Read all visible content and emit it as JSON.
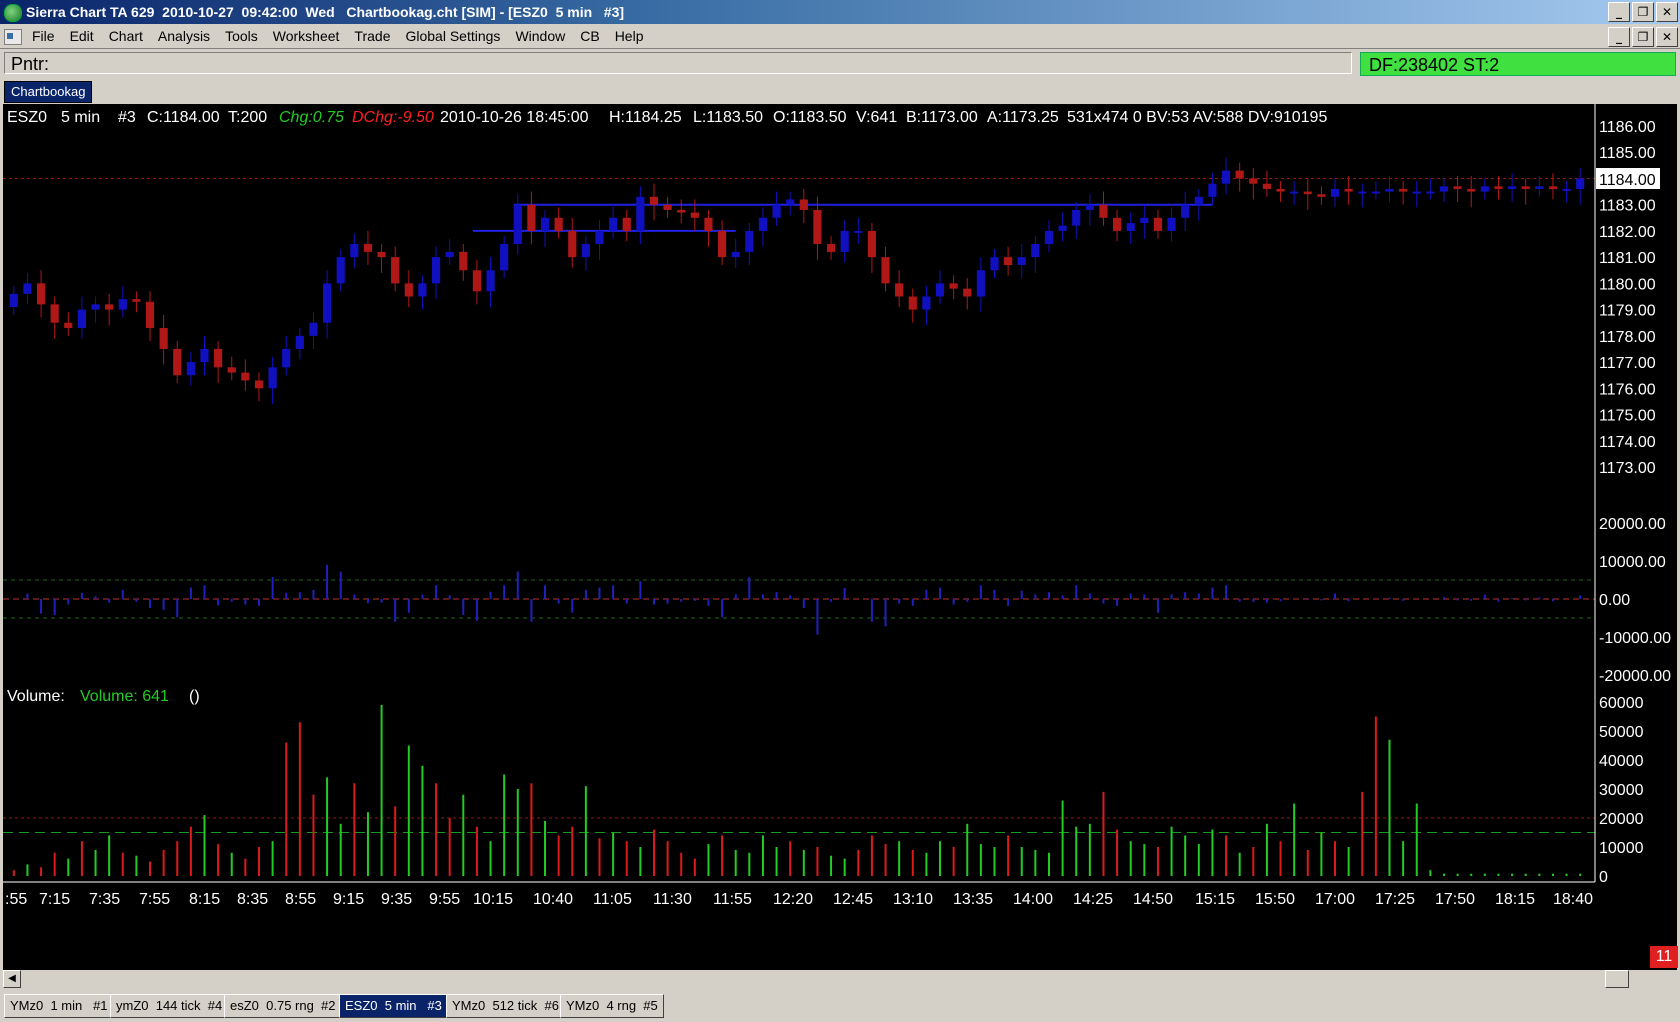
{
  "window": {
    "title": "Sierra Chart TA 629  2010-10-27  09:42:00  Wed   Chartbookag.cht [SIM] - [ESZ0  5 min   #3]",
    "buttons": [
      "_",
      "❐",
      "✕"
    ]
  },
  "menu": {
    "items": [
      "File",
      "Edit",
      "Chart",
      "Analysis",
      "Tools",
      "Worksheet",
      "Trade",
      "Global Settings",
      "Window",
      "CB",
      "Help"
    ]
  },
  "pointer_bar": {
    "label": "Pntr:",
    "status": "DF:238402   ST:2"
  },
  "chartbook_tab": "Chartbookag",
  "chart_header": {
    "symbol": "ESZ0",
    "interval": "5 min",
    "chart_no": "#3",
    "close": "C:1184.00",
    "trades": "T:200",
    "chg": "Chg:0.75",
    "dchg": "DChg:-9.50",
    "datetime": "2010-10-26 18:45:00",
    "high": "H:1184.25",
    "low": "L:1183.50",
    "open": "O:1183.50",
    "vol": "V:641",
    "bid": "B:1173.00",
    "ask": "A:1173.25",
    "tail": "531x474 0 BV:53 AV:588 DV:910195"
  },
  "volume_header": {
    "label": "Volume:",
    "value": "Volume: 641",
    "paren": "()"
  },
  "price_axis": [
    "1186.00",
    "1185.00",
    "1184.00",
    "1183.00",
    "1182.00",
    "1181.00",
    "1180.00",
    "1179.00",
    "1178.00",
    "1177.00",
    "1176.00",
    "1175.00",
    "1174.00",
    "1173.00"
  ],
  "current_price_label": "1184.00",
  "delta_axis": [
    "20000.00",
    "10000.00",
    "0.00",
    "-10000.00",
    "-20000.00"
  ],
  "volume_axis": [
    "60000",
    "50000",
    "40000",
    "30000",
    "20000",
    "10000",
    "0"
  ],
  "time_axis": [
    ":55",
    "7:15",
    "7:35",
    "7:55",
    "8:15",
    "8:35",
    "8:55",
    "9:15",
    "9:35",
    "9:55",
    "10:15",
    "10:40",
    "11:05",
    "11:30",
    "11:55",
    "12:20",
    "12:45",
    "13:10",
    "13:35",
    "14:00",
    "14:25",
    "14:50",
    "15:15",
    "15:50",
    "17:00",
    "17:25",
    "17:50",
    "18:15",
    "18:40"
  ],
  "bottom_right_badge": "11",
  "chart_tabs": [
    {
      "label": "YMz0  1 min   #1",
      "active": false
    },
    {
      "label": "ymZ0  144 tick  #4",
      "active": false
    },
    {
      "label": "esZ0  0.75 rng  #2",
      "active": false
    },
    {
      "label": "ESZ0  5 min   #3",
      "active": true
    },
    {
      "label": "YMz0  512 tick  #6",
      "active": false
    },
    {
      "label": "YMz0  4 rng  #5",
      "active": false
    }
  ],
  "colors": {
    "up": "#1010c0",
    "down": "#b01818",
    "vol_up": "#22cc22",
    "vol_down": "#dd1a1a",
    "bg": "#000000",
    "positive": "#22cc22",
    "negative": "#ff2020"
  },
  "chart_data": [
    {
      "type": "candlestick",
      "title": "ESZ0  5 min",
      "ylim": [
        1172.0,
        1186.5
      ],
      "current_price": 1184.0,
      "closes": [
        1179.6,
        1180.0,
        1179.2,
        1178.5,
        1178.3,
        1179.0,
        1179.2,
        1179.0,
        1179.4,
        1179.3,
        1178.3,
        1177.5,
        1176.5,
        1177.0,
        1177.5,
        1176.8,
        1176.6,
        1176.3,
        1176.0,
        1176.8,
        1177.5,
        1178.0,
        1178.5,
        1180.0,
        1181.0,
        1181.5,
        1181.2,
        1181.0,
        1180.0,
        1179.5,
        1180.0,
        1181.0,
        1181.2,
        1180.5,
        1179.7,
        1180.5,
        1181.5,
        1183.0,
        1182.0,
        1182.5,
        1182.0,
        1181.0,
        1181.5,
        1182.0,
        1182.5,
        1182.0,
        1183.3,
        1183.0,
        1182.8,
        1182.7,
        1182.5,
        1182.0,
        1181.0,
        1181.2,
        1182.0,
        1182.5,
        1183.0,
        1183.2,
        1182.8,
        1181.5,
        1181.2,
        1182.0,
        1182.0,
        1181.0,
        1180.0,
        1179.5,
        1179.0,
        1179.5,
        1180.0,
        1179.8,
        1179.5,
        1180.5,
        1181.0,
        1180.7,
        1181.0,
        1181.5,
        1182.0,
        1182.2,
        1182.8,
        1183.0,
        1182.5,
        1182.0,
        1182.3,
        1182.5,
        1182.0,
        1182.5,
        1183.0,
        1183.3,
        1183.8,
        1184.3,
        1184.0,
        1183.8,
        1183.6,
        1183.5,
        1183.5,
        1183.4,
        1183.3,
        1183.6,
        1183.5,
        1183.5,
        1183.5,
        1183.6,
        1183.5,
        1183.5,
        1183.5,
        1183.7,
        1183.6,
        1183.5,
        1183.7,
        1183.6,
        1183.7,
        1183.6,
        1183.7,
        1183.6,
        1183.6,
        1184.0
      ]
    },
    {
      "type": "bar",
      "title": "Volume",
      "ylim": [
        0,
        62000
      ],
      "values": [
        2000,
        4000,
        3000,
        8000,
        6000,
        12000,
        9000,
        14000,
        8000,
        7000,
        5000,
        9000,
        12000,
        17000,
        21000,
        11000,
        8000,
        6000,
        10000,
        12000,
        46000,
        53000,
        28000,
        34000,
        18000,
        32000,
        22000,
        59000,
        24000,
        45000,
        38000,
        32000,
        20000,
        28000,
        17000,
        12000,
        35000,
        30000,
        32000,
        19000,
        14000,
        17000,
        31000,
        13000,
        15000,
        12000,
        10000,
        16000,
        12000,
        8000,
        6000,
        11000,
        14000,
        9000,
        8000,
        14000,
        10000,
        12000,
        9000,
        10000,
        7000,
        6000,
        9000,
        14000,
        11000,
        12000,
        9000,
        8000,
        12000,
        10000,
        18000,
        11000,
        10000,
        14000,
        10000,
        9000,
        8000,
        26000,
        17000,
        18000,
        29000,
        16000,
        12000,
        11000,
        10000,
        17000,
        14000,
        11000,
        16000,
        14000,
        8000,
        10000,
        18000,
        12000,
        25000,
        9000,
        15000,
        12000,
        10000,
        29000,
        55000,
        47000,
        12000,
        25000,
        2000,
        800,
        800,
        800,
        800,
        800,
        800,
        800,
        800,
        800,
        800,
        800
      ],
      "up_flags": [
        0,
        1,
        0,
        0,
        1,
        0,
        1,
        1,
        0,
        1,
        0,
        0,
        0,
        0,
        1,
        0,
        1,
        0,
        0,
        1,
        0,
        0,
        0,
        1,
        1,
        0,
        1,
        1,
        0,
        1,
        1,
        0,
        0,
        1,
        0,
        1,
        1,
        1,
        0,
        1,
        0,
        0,
        1,
        0,
        1,
        0,
        1,
        0,
        0,
        0,
        0,
        1,
        0,
        1,
        1,
        1,
        1,
        0,
        1,
        0,
        1,
        1,
        0,
        0,
        0,
        1,
        0,
        1,
        1,
        0,
        1,
        1,
        1,
        0,
        1,
        1,
        1,
        1,
        1,
        1,
        0,
        0,
        1,
        1,
        0,
        1,
        1,
        1,
        1,
        0,
        1,
        0,
        1,
        0,
        1,
        0,
        1,
        0,
        1,
        0,
        0,
        1,
        1,
        1,
        1,
        1,
        1,
        1,
        1,
        1,
        1,
        1,
        1,
        1,
        1,
        1
      ]
    }
  ]
}
